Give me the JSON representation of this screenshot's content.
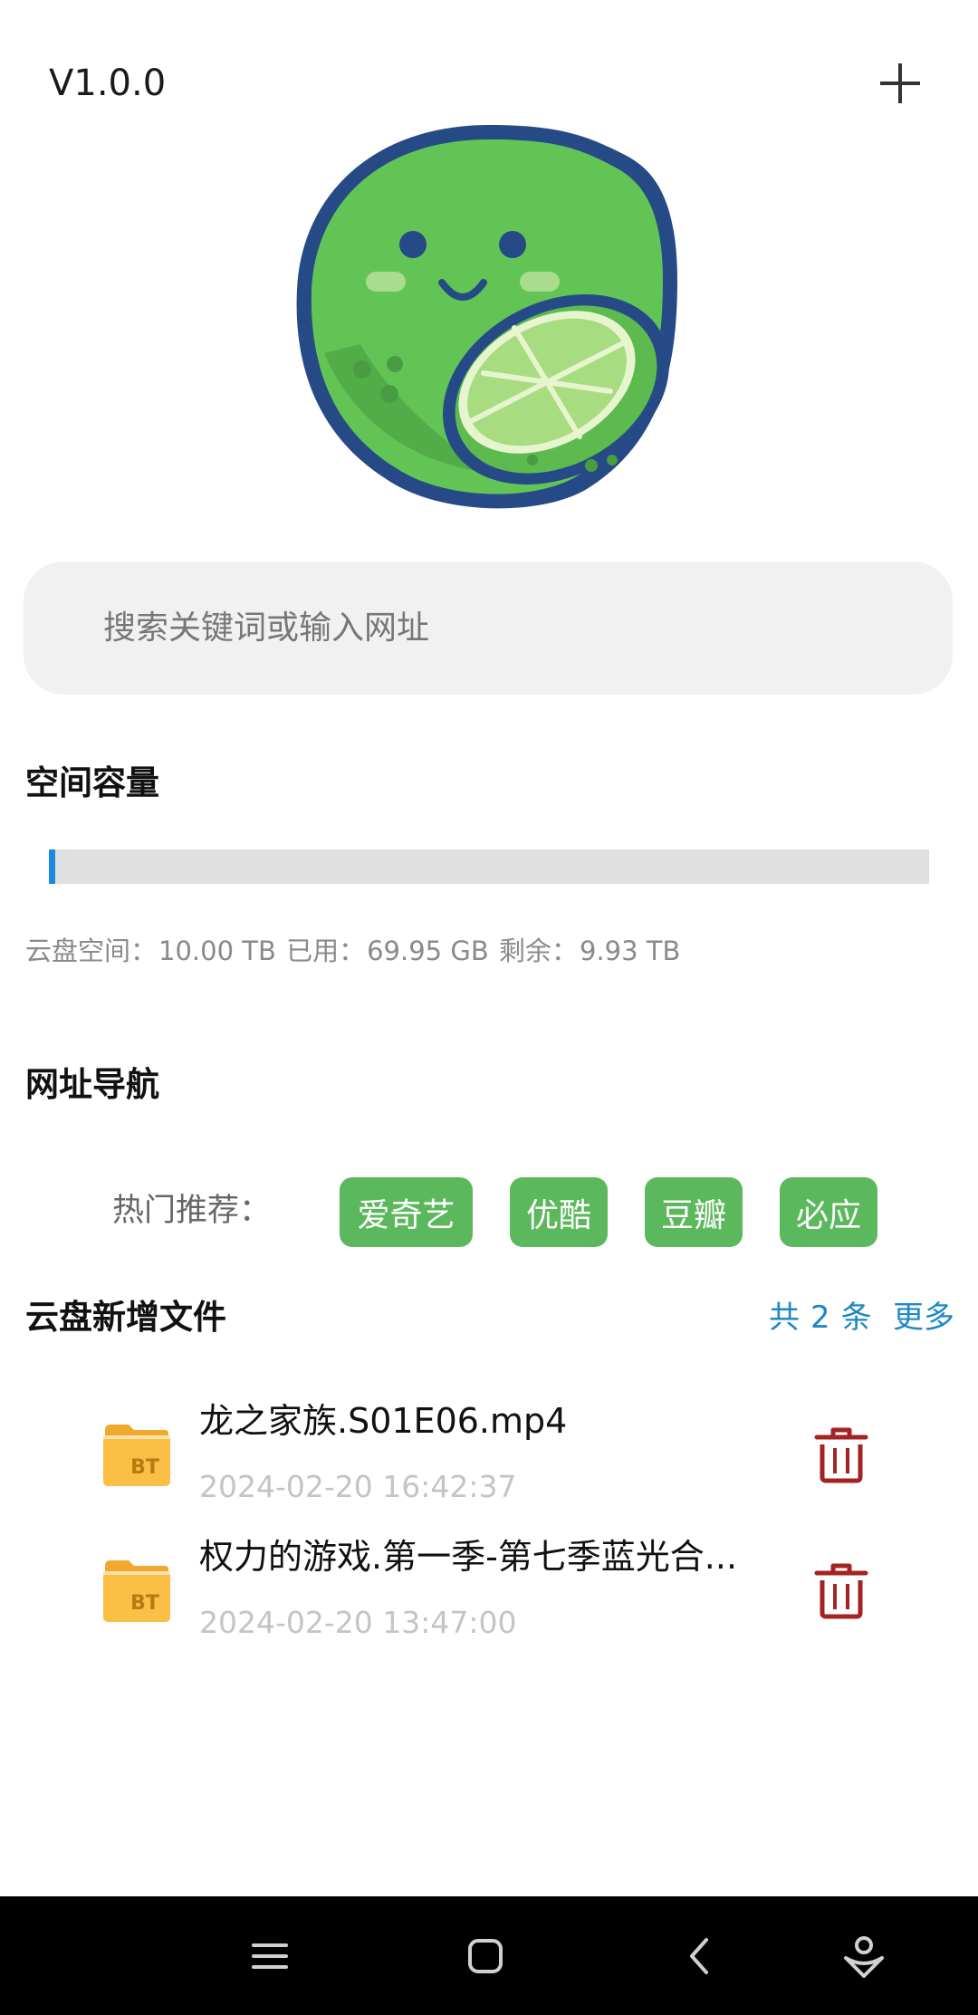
{
  "header": {
    "version": "V1.0.0",
    "add_icon": "plus-icon"
  },
  "logo": {
    "icon": "lime-mascot-logo"
  },
  "search": {
    "placeholder": "搜索关键词或输入网址",
    "value": ""
  },
  "storage": {
    "title": "空间容量",
    "used_fraction": 0.0068,
    "bar_color": "#1e88e5",
    "total_label": "云盘空间：",
    "total_value": "10.00 TB",
    "used_label": "已用：",
    "used_value": "69.95 GB",
    "remaining_label": "剩余：",
    "remaining_value": "9.93 TB"
  },
  "navigation": {
    "title": "网址导航",
    "hot_label": "热门推荐：",
    "chip_color": "#5cb85c",
    "links": [
      {
        "label": "爱奇艺"
      },
      {
        "label": "优酷"
      },
      {
        "label": "豆瓣"
      },
      {
        "label": "必应"
      }
    ]
  },
  "files": {
    "title": "云盘新增文件",
    "count_prefix": "共",
    "count": "2",
    "count_suffix": "条",
    "more_label": "更多",
    "link_color": "#1e88c8",
    "items": [
      {
        "name": "龙之家族.S01E06.mp4",
        "date": "2024-02-20 16:42:37",
        "icon": "bt-folder-icon",
        "action_icon": "trash-icon"
      },
      {
        "name": "权力的游戏.第一季-第七季蓝光合...",
        "date": "2024-02-20 13:47:00",
        "icon": "bt-folder-icon",
        "action_icon": "trash-icon"
      }
    ]
  },
  "system_nav": {
    "icons": [
      "menu-icon",
      "home-icon",
      "back-icon",
      "assistant-icon"
    ]
  }
}
